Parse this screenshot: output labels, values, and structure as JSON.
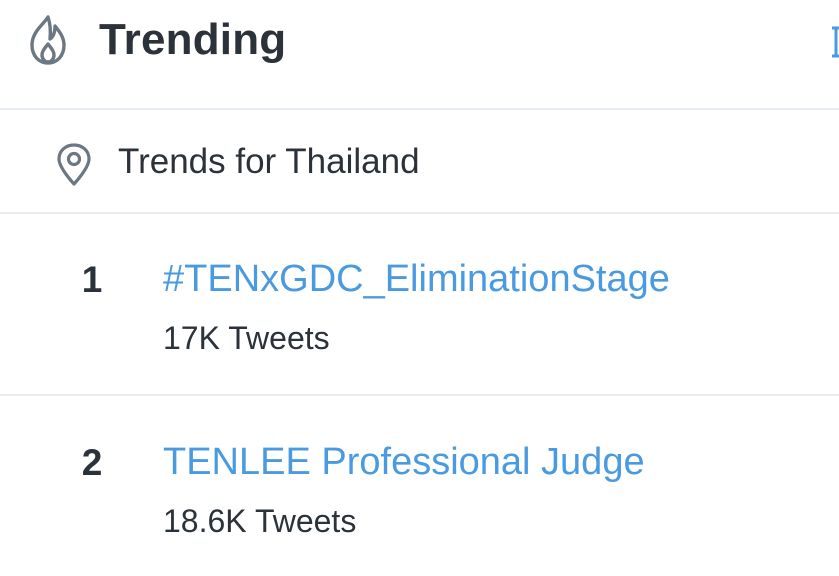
{
  "header": {
    "title": "Trending",
    "icon": "fire-icon",
    "action_icon": "more-icon"
  },
  "location": {
    "icon": "location-pin-icon",
    "label": "Trends for Thailand"
  },
  "trends": [
    {
      "rank": "1",
      "name": "#TENxGDC_EliminationStage",
      "count": "17K Tweets"
    },
    {
      "rank": "2",
      "name": "TENLEE Professional Judge",
      "count": "18.6K Tweets"
    }
  ],
  "colors": {
    "text": "#2b323a",
    "link": "#4a9ae0",
    "divider": "#e6ecf0",
    "icon": "#6b7782"
  }
}
